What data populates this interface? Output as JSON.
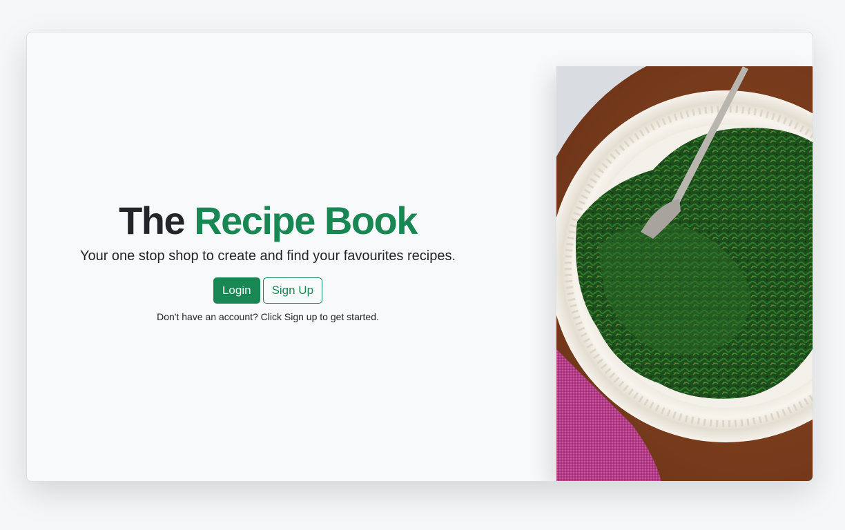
{
  "hero": {
    "title_prefix": "The",
    "title_accent": "Recipe Book",
    "subtitle": "Your one stop shop to create and find your favourites recipes.",
    "login_label": "Login",
    "signup_label": "Sign Up",
    "hint": "Don't have an account? Click Sign up to get started."
  },
  "image": {
    "alt": "plate of sautéed greens with a fork"
  },
  "colors": {
    "accent": "#198754",
    "text": "#212529",
    "card_bg": "#f8f9fa"
  }
}
